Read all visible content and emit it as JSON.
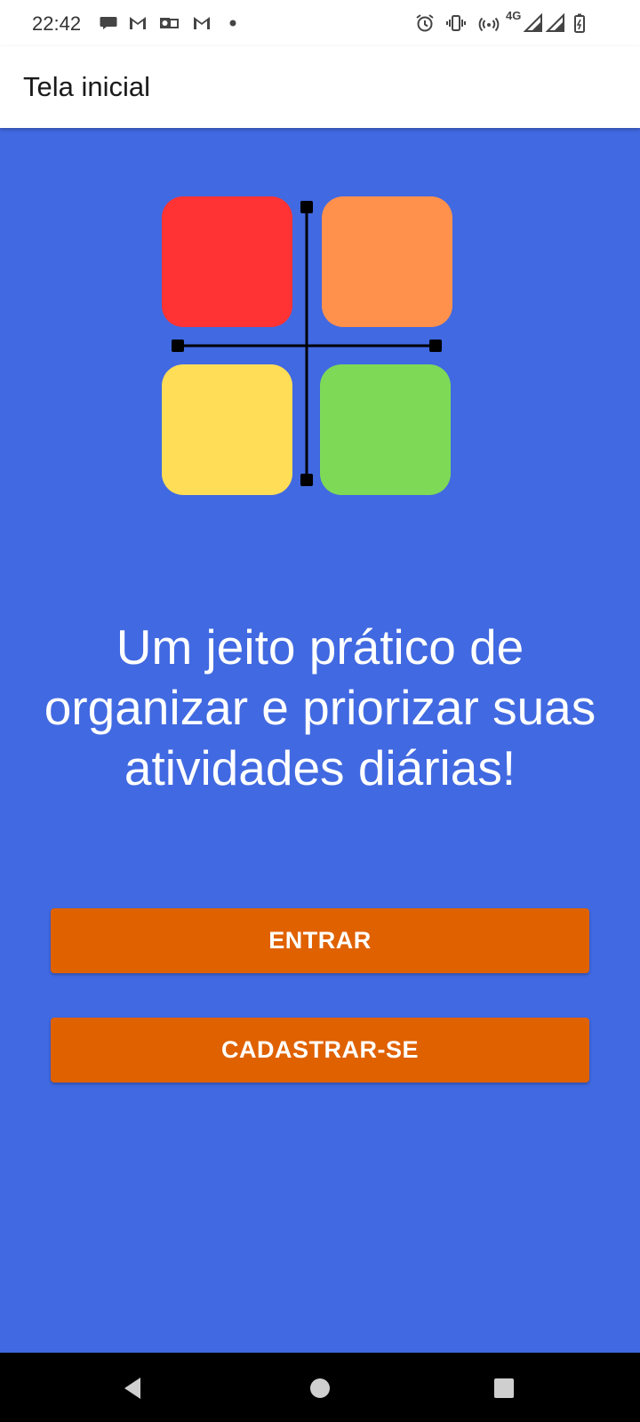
{
  "status_bar": {
    "time": "22:42",
    "network": "4G",
    "left_icons": [
      "chat-bubble-icon",
      "gmail-icon",
      "outlook-icon",
      "gmail-icon",
      "dot-icon"
    ],
    "right_icons": [
      "alarm-icon",
      "vibrate-icon",
      "hotspot-icon",
      "network-4g-icon",
      "signal-icon",
      "signal-icon",
      "battery-charging-icon"
    ]
  },
  "app_bar": {
    "title": "Tela inicial"
  },
  "main": {
    "background": "#4169e1",
    "logo": {
      "colors": {
        "top_left": "#ff3333",
        "top_right": "#ff914d",
        "bottom_left": "#ffdd57",
        "bottom_right": "#7ed957",
        "axes": "#000000"
      }
    },
    "tagline": "Um jeito prático de organizar e priorizar suas atividades diárias!",
    "buttons": {
      "enter_label": "ENTRAR",
      "signup_label": "CADASTRAR-SE",
      "color": "#e06100"
    }
  },
  "nav_bar": {
    "icons": [
      "back-icon",
      "home-icon",
      "recents-icon"
    ]
  }
}
